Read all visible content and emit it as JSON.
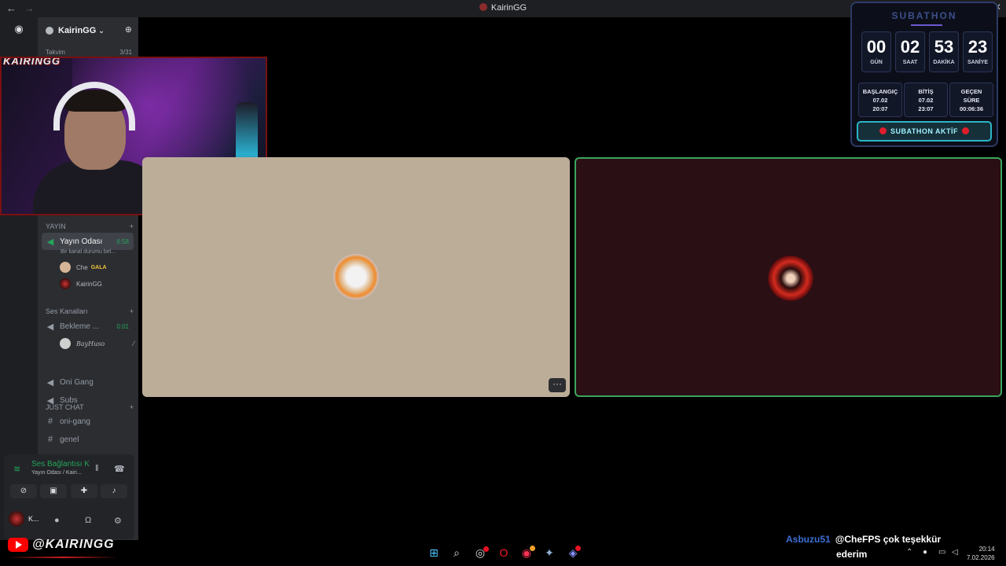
{
  "window": {
    "title": "KairinGG",
    "controls": [
      "–",
      "☐",
      "✕"
    ]
  },
  "server": {
    "name": "KairinGG",
    "sub_left": "Takvim",
    "sub_right": "3/31"
  },
  "sidebar": {
    "category_yayin": "YAYIN",
    "active_channel": {
      "name": "Yayın Odası",
      "time": "6:58",
      "status": "Bir kanal durumu bel..."
    },
    "voice_users": [
      {
        "name": "Che",
        "tag": "GALA"
      },
      {
        "name": "KairinGG",
        "tag": ""
      }
    ],
    "category_voice": "Ses Kanalları",
    "bekleme": {
      "name": "Bekleme ...",
      "time": "0:01"
    },
    "bekleme_user": "BayHuso",
    "voice_channels": [
      "Oni Gang",
      "Subs"
    ],
    "category_chat": "JUST CHAT",
    "text_channels": [
      "oni-gang",
      "genel"
    ]
  },
  "voice_panel": {
    "status": "Ses Bağlantısı K",
    "location": "Yayın Odası / Kairi...",
    "user_short": "K..."
  },
  "webcam": {
    "stamp": "KAIRINGG"
  },
  "subathon": {
    "title": "SUBATHON",
    "countdown": [
      {
        "value": "00",
        "label": "GÜN"
      },
      {
        "value": "02",
        "label": "SAAT"
      },
      {
        "value": "53",
        "label": "DAKİKA"
      },
      {
        "value": "23",
        "label": "SANİYE"
      }
    ],
    "start": {
      "label": "BAŞLANGIÇ",
      "date": "07.02",
      "time": "20:07"
    },
    "end": {
      "label": "BİTİŞ",
      "date": "07.02",
      "time": "23:07"
    },
    "elapsed": {
      "label_1": "GEÇEN",
      "label_2": "SÜRE",
      "value": "00:06:36"
    },
    "active_label": "SUBATHON AKTİF"
  },
  "branding": {
    "handle": "@KAIRINGG"
  },
  "chat_ticker": {
    "author": "Asbuzu51",
    "message_1": "@CheFPS çok teşekkür",
    "message_2": "ederim"
  },
  "taskbar": {
    "time": "20:14",
    "date": "7.02.2026",
    "icons": [
      "windows-icon",
      "search-icon",
      "steam-icon",
      "opera-icon",
      "app-icon",
      "app2-icon",
      "discord-icon"
    ]
  },
  "colors": {
    "accent_green": "#23a55a",
    "subathon_cyan": "#2bb5c7",
    "tile_left_bg": "#bcad99",
    "tile_right_bg": "#2a0f15"
  }
}
